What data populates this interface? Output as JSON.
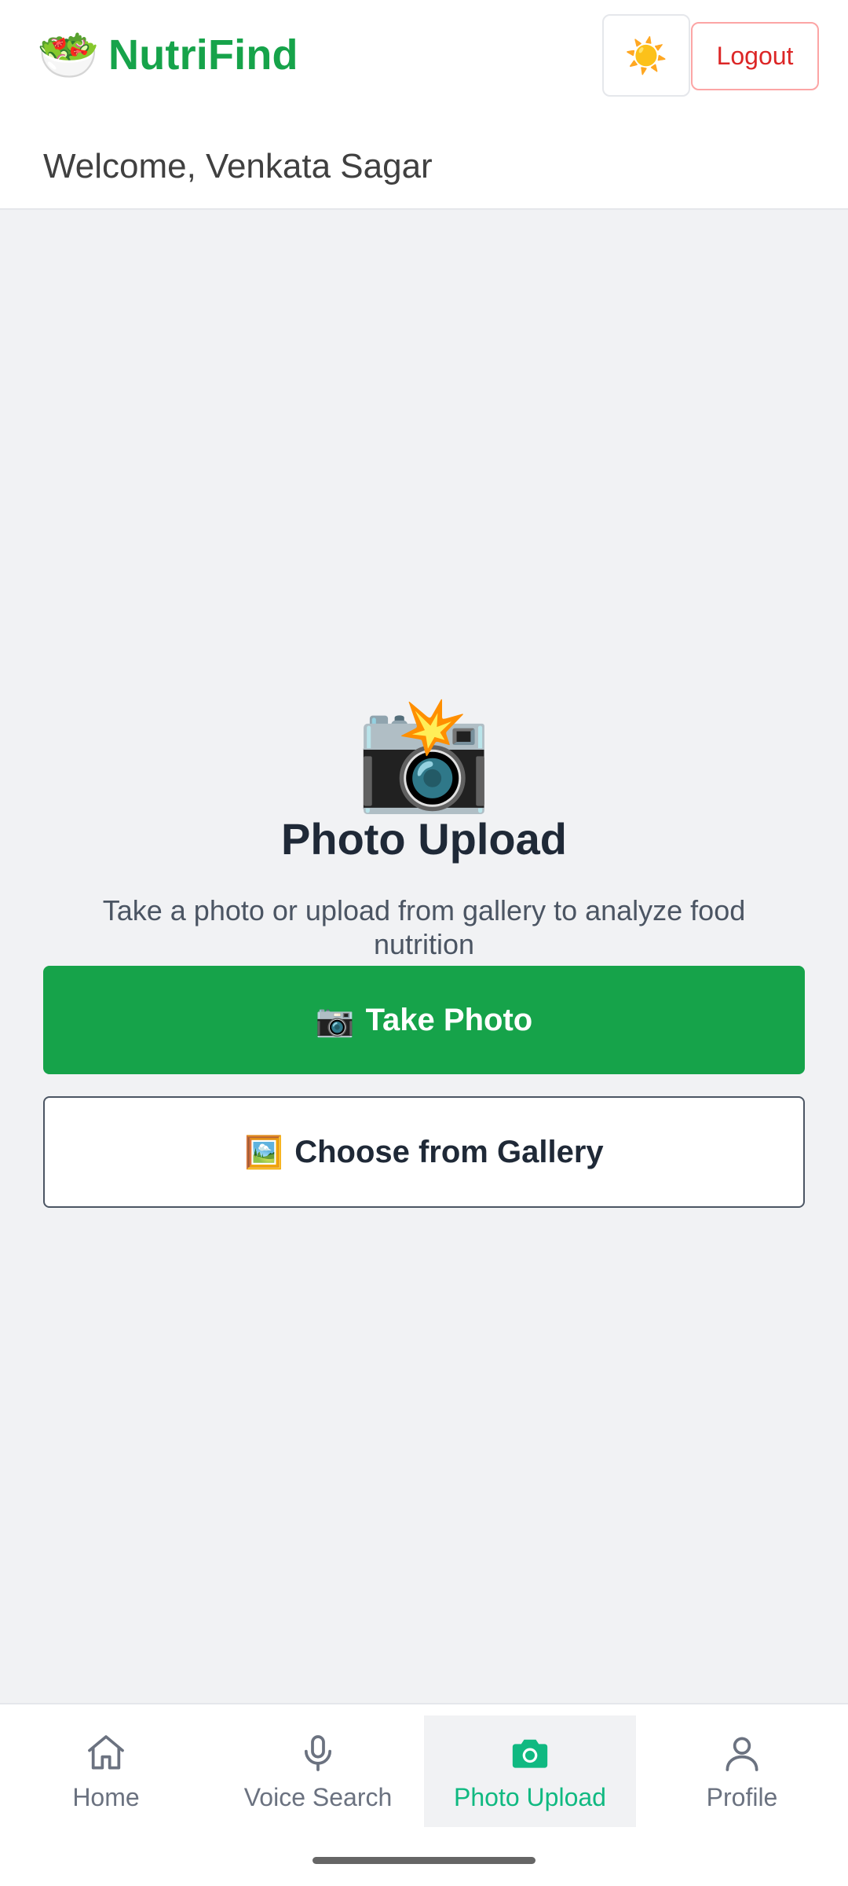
{
  "header": {
    "brand_logo": "🥗",
    "brand_name": "NutriFind",
    "theme_icon": "☀️",
    "logout_label": "Logout"
  },
  "welcome": {
    "text": "Welcome, Venkata Sagar"
  },
  "photo_upload": {
    "hero_icon": "📸",
    "title": "Photo Upload",
    "subtitle": "Take a photo or upload from gallery to analyze food nutrition",
    "take_photo_emoji": "📷",
    "take_photo_label": "Take Photo",
    "gallery_emoji": "🖼️",
    "gallery_label": "Choose from Gallery"
  },
  "bottom_nav": {
    "items": [
      {
        "label": "Home",
        "icon": "home-icon"
      },
      {
        "label": "Voice Search",
        "icon": "microphone-icon"
      },
      {
        "label": "Photo Upload",
        "icon": "camera-icon",
        "active": true
      },
      {
        "label": "Profile",
        "icon": "user-icon"
      }
    ]
  },
  "colors": {
    "brand_green": "#16a34a",
    "active_tab": "#10b981",
    "logout_red": "#dc2626",
    "background": "#f1f2f4"
  }
}
